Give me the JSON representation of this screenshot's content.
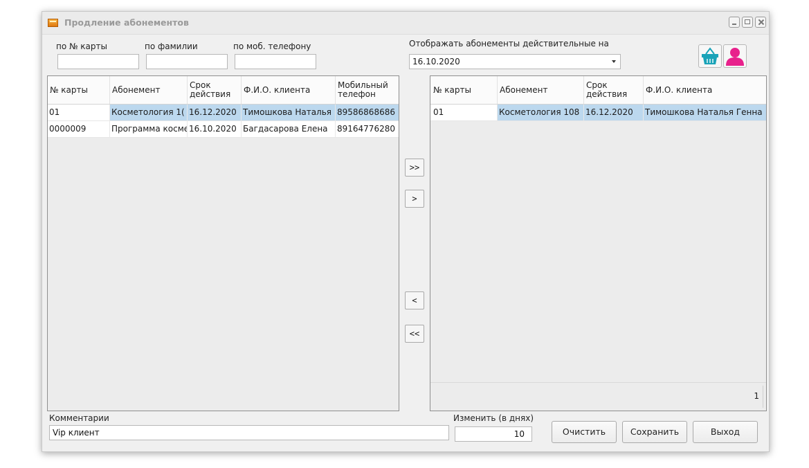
{
  "window": {
    "title": "Продление абонементов",
    "controls": [
      "minimize",
      "maximize",
      "close"
    ]
  },
  "filters": {
    "card_label": "по № карты",
    "card_value": "",
    "surname_label": "по фамилии",
    "surname_value": "",
    "phone_label": "по моб. телефону",
    "phone_value": ""
  },
  "date_filter": {
    "label": "Отображать абонементы действительные на",
    "value": "16.10.2020"
  },
  "icons": {
    "basket": "basket-icon",
    "client": "client-icon",
    "basket_color": "#1aa3b8",
    "client_color": "#e8218c"
  },
  "left_grid": {
    "headers": [
      "№ карты",
      "Абонемент",
      "Срок действия",
      "Ф.И.О. клиента",
      "Мобильный телефон"
    ],
    "rows": [
      {
        "card": "01",
        "sub": "Косметология 1(",
        "term": "16.12.2020",
        "name": "Тимошкова Наталья",
        "phone": "89586868686"
      },
      {
        "card": "0000009",
        "sub": "Программа косме",
        "term": "16.10.2020",
        "name": "Багдасарова Елена",
        "phone": "89164776280"
      }
    ]
  },
  "move_buttons": {
    "all_right": ">>",
    "right": ">",
    "left": "<",
    "all_left": "<<"
  },
  "right_grid": {
    "headers": [
      "№ карты",
      "Абонемент",
      "Срок действия",
      "Ф.И.О. клиента"
    ],
    "rows": [
      {
        "card": "01",
        "sub": "Косметология 108",
        "term": "16.12.2020",
        "name": "Тимошкова Наталья Генна"
      }
    ],
    "count": "1"
  },
  "comments": {
    "label": "Комментарии",
    "value": "Vip клиент"
  },
  "change_days": {
    "label": "Изменить (в днях)",
    "value": "10"
  },
  "buttons": {
    "clear": "Очистить",
    "save": "Сохранить",
    "exit": "Выход"
  },
  "colors": {
    "selection": "#bcd8ee"
  }
}
